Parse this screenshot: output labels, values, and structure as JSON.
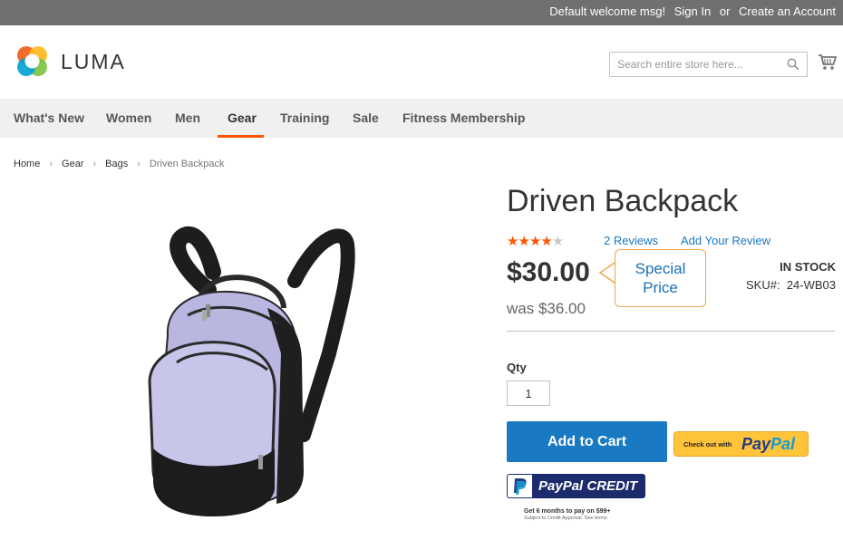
{
  "topbar": {
    "welcome": "Default welcome msg!",
    "sign_in": "Sign In",
    "or": "or",
    "create_account": "Create an Account"
  },
  "header": {
    "logo_text": "LUMA",
    "search_placeholder": "Search entire store here..."
  },
  "nav": {
    "items": [
      {
        "label": "What's New"
      },
      {
        "label": "Women"
      },
      {
        "label": "Men"
      },
      {
        "label": "Gear",
        "active": true
      },
      {
        "label": "Training"
      },
      {
        "label": "Sale"
      },
      {
        "label": "Fitness Membership"
      }
    ]
  },
  "breadcrumb": [
    "Home",
    "Gear",
    "Bags",
    "Driven Backpack"
  ],
  "product": {
    "title": "Driven Backpack",
    "rating_stars": 4.5,
    "reviews_link": "2 Reviews",
    "add_review_link": "Add Your Review",
    "price": "$30.00",
    "old_price": "was $36.00",
    "callout": "Special Price",
    "stock": "IN STOCK",
    "sku_label": "SKU#:",
    "sku_value": "24-WB03",
    "qty_label": "Qty",
    "qty_value": "1",
    "add_to_cart": "Add to Cart"
  },
  "paypal": {
    "checkout_small": "Check out with",
    "pay": "Pay",
    "pal": "Pal",
    "credit_label": "PayPal CREDIT",
    "credit_note": "Get 6 months to pay on $99+",
    "credit_sub": "Subject to Credit Approval. See terms"
  },
  "colors": {
    "topbar": "#6e716e",
    "accent_orange": "#ff5501",
    "link_blue": "#1979c3",
    "nav_bg": "#f0f0f0",
    "paypal_yellow": "#ffc439",
    "paypal_navy": "#1c2b6b"
  }
}
